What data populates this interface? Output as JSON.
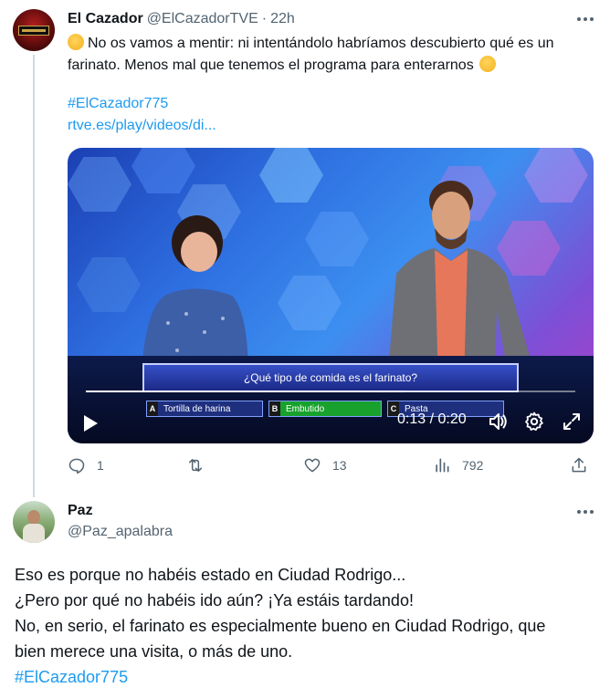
{
  "tweet1": {
    "author_name": "El Cazador",
    "handle": "@ElCazadorTVE",
    "separator": "·",
    "time": "22h",
    "text": "No os vamos a mentir: ni intentándolo habríamos descubierto qué es un farinato. Menos mal que tenemos el programa para enterarnos",
    "hashtag": "#ElCazador775",
    "url": "rtve.es/play/videos/di...",
    "video": {
      "question": "¿Qué tipo de comida es el farinato?",
      "answers": [
        {
          "letter": "A",
          "text": "Tortilla de harina"
        },
        {
          "letter": "B",
          "text": "Embutido"
        },
        {
          "letter": "C",
          "text": "Pasta"
        }
      ],
      "time_display": "0:13 / 0:20",
      "progress": 0.65
    },
    "actions": {
      "replies": "1",
      "retweets": "",
      "likes": "13",
      "views": "792"
    }
  },
  "tweet2": {
    "author_name": "Paz",
    "handle": "@Paz_apalabra",
    "lines": [
      "Eso es porque no habéis estado en Ciudad Rodrigo...",
      "¿Pero por qué no habéis ido aún? ¡Ya estáis tardando!",
      "No, en serio, el farinato es especialmente bueno en Ciudad Rodrigo, que",
      "bien merece una visita, o más de uno."
    ],
    "hashtag": "#ElCazador775"
  },
  "colors": {
    "link": "#1d9bf0",
    "secondary": "#536471",
    "primary": "#0f1419"
  }
}
